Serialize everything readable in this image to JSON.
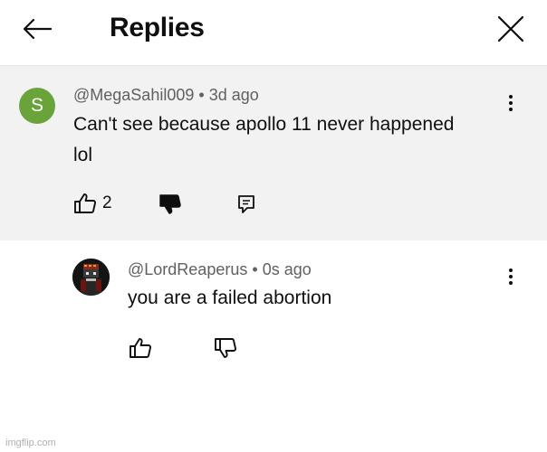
{
  "header": {
    "title": "Replies",
    "back_icon": "arrow-left-icon",
    "close_icon": "close-icon"
  },
  "parent_comment": {
    "avatar_letter": "S",
    "avatar_color": "#69a33a",
    "username": "@MegaSahil009",
    "age": "3d ago",
    "text_line1": "Can't see because apollo 11 never happened",
    "text_line2": "lol",
    "likes": "2"
  },
  "reply": {
    "username": "@LordReaperus",
    "age": "0s ago",
    "text": "you are a failed abortion"
  },
  "watermark": "imgflip.com"
}
